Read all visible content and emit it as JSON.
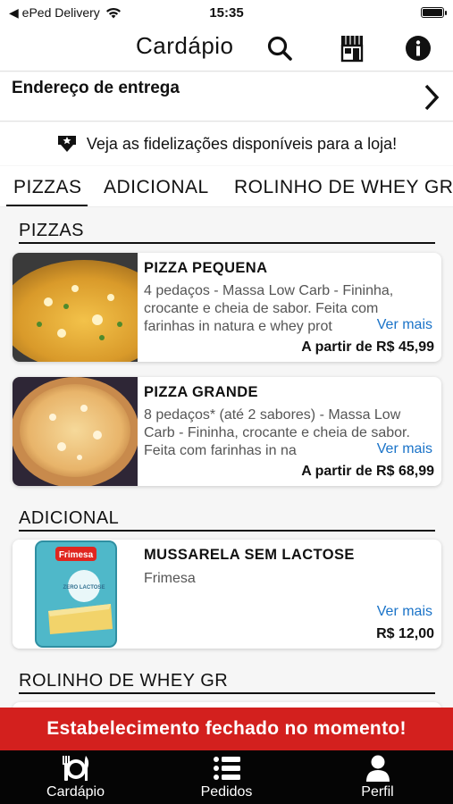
{
  "status_bar": {
    "back_app": "◀ ePed Delivery",
    "time": "15:35"
  },
  "header": {
    "title": "Cardápio"
  },
  "address": {
    "label": "Endereço de entrega"
  },
  "loyalty": {
    "text": "Veja as fidelizações disponíveis para a loja!"
  },
  "tabs": [
    {
      "label": "PIZZAS",
      "active": true
    },
    {
      "label": "ADICIONAL",
      "active": false
    },
    {
      "label": "ROLINHO DE WHEY GR",
      "active": false
    }
  ],
  "sections": [
    {
      "title": "PIZZAS",
      "items": [
        {
          "name": "PIZZA PEQUENA",
          "description": "4 pedaços - Massa Low Carb - Fininha, crocante e cheia de sabor. Feita com farinhas in natura e whey prot",
          "more": "Ver mais",
          "price": "A partir de R$ 45,99"
        },
        {
          "name": "PIZZA GRANDE",
          "description": "8 pedaços* (até 2 sabores) - Massa Low Carb - Fininha, crocante e cheia de sabor. Feita com farinhas in na",
          "more": "Ver mais",
          "price": "A partir de R$ 68,99"
        }
      ]
    },
    {
      "title": "ADICIONAL",
      "items": [
        {
          "name": "MUSSARELA SEM LACTOSE",
          "description": "Frimesa",
          "more": "Ver mais",
          "price": "R$ 12,00",
          "package_brand": "Frimesa",
          "package_text": "ZERO LACTOSE"
        }
      ]
    },
    {
      "title": "ROLINHO DE WHEY GR"
    }
  ],
  "closed_banner": "Estabelecimento fechado no momento!",
  "bottom_nav": [
    {
      "label": "Cardápio",
      "icon": "cutlery-plate-icon"
    },
    {
      "label": "Pedidos",
      "icon": "list-icon"
    },
    {
      "label": "Perfil",
      "icon": "person-icon"
    }
  ],
  "colors": {
    "accent_link": "#1a73c8",
    "closed_banner": "#d3201e",
    "nav_bg": "#050505"
  }
}
